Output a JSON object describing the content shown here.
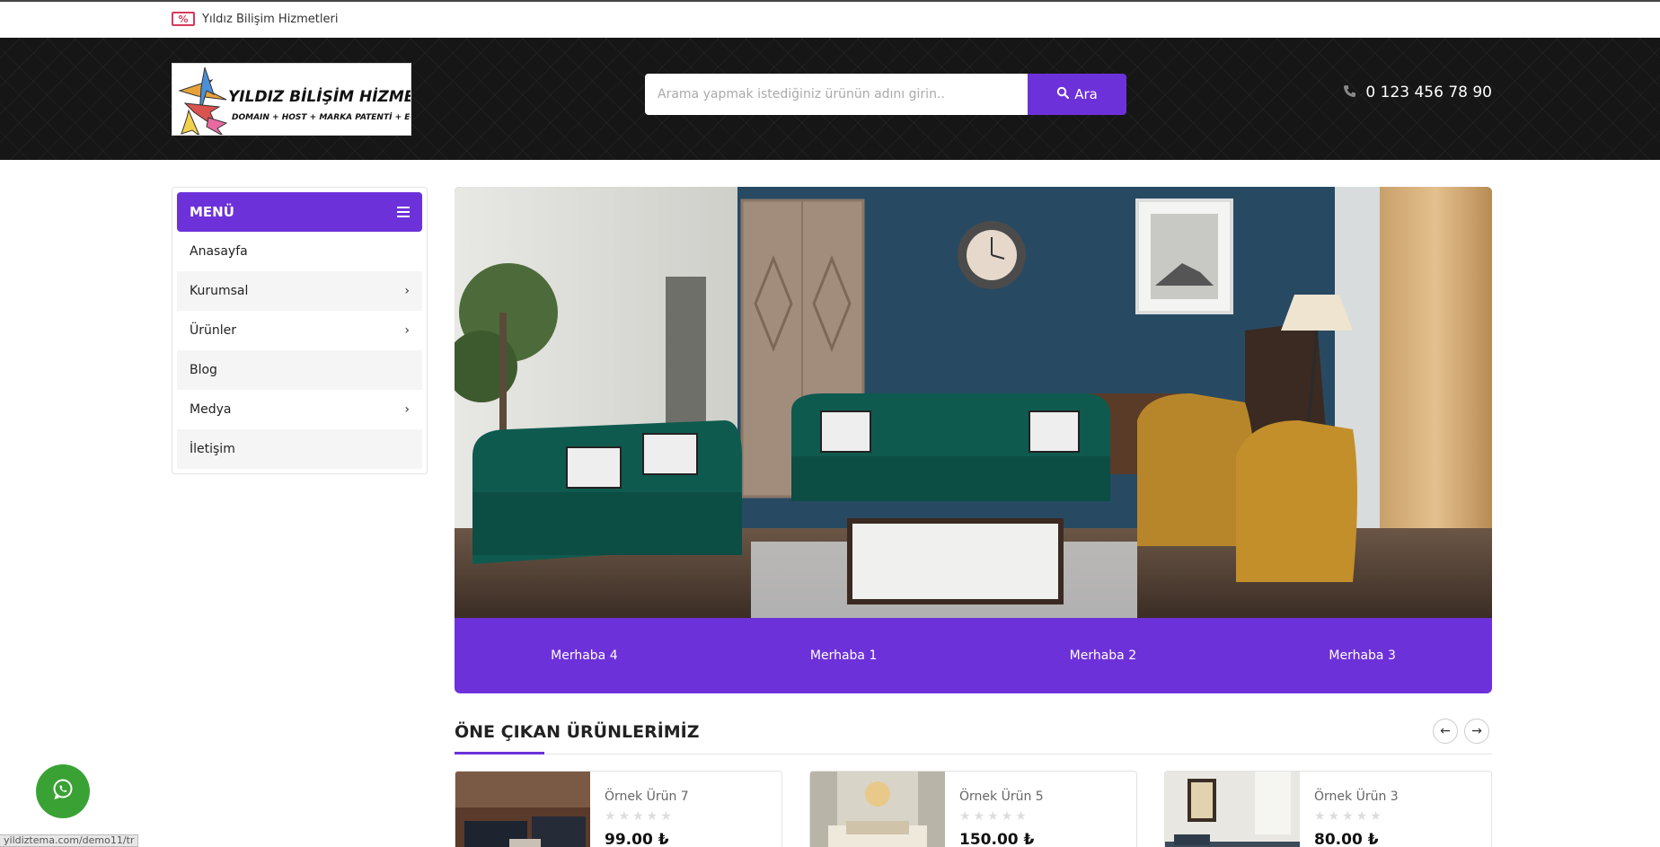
{
  "topbar": {
    "brand_text": "Yıldız Bilişim Hizmetleri",
    "brand_icon": "percent-tag-icon"
  },
  "header": {
    "logo_title": "YILDIZ BİLİŞİM HİZMETLERİ",
    "logo_subtitle": "DOMAIN + HOST + MARKA PATENTİ + E-İMZA",
    "search_placeholder": "Arama yapmak istediğiniz ürünün adını girin..",
    "search_button": "Ara",
    "phone": "0 123 456 78 90"
  },
  "menu": {
    "title": "MENÜ",
    "items": [
      {
        "label": "Anasayfa",
        "has_children": false
      },
      {
        "label": "Kurumsal",
        "has_children": true
      },
      {
        "label": "Ürünler",
        "has_children": true
      },
      {
        "label": "Blog",
        "has_children": false
      },
      {
        "label": "Medya",
        "has_children": true
      },
      {
        "label": "İletişim",
        "has_children": false
      }
    ]
  },
  "slider": {
    "tabs": [
      "Merhaba 4",
      "Merhaba 1",
      "Merhaba 2",
      "Merhaba 3"
    ]
  },
  "featured": {
    "title": "ÖNE ÇIKAN ÜRÜNLERİMİZ",
    "products": [
      {
        "name": "Örnek Ürün 7",
        "price": "99.00 ₺",
        "stars": "★★★★★"
      },
      {
        "name": "Örnek Ürün 5",
        "price": "150.00 ₺",
        "stars": "★★★★★"
      },
      {
        "name": "Örnek Ürün 3",
        "price": "80.00 ₺",
        "stars": "★★★★★"
      }
    ]
  },
  "status_url": "yildiztema.com/demo11/tr",
  "colors": {
    "accent": "#6d31d9",
    "header_bg": "#161616",
    "whatsapp": "#3aa235"
  }
}
